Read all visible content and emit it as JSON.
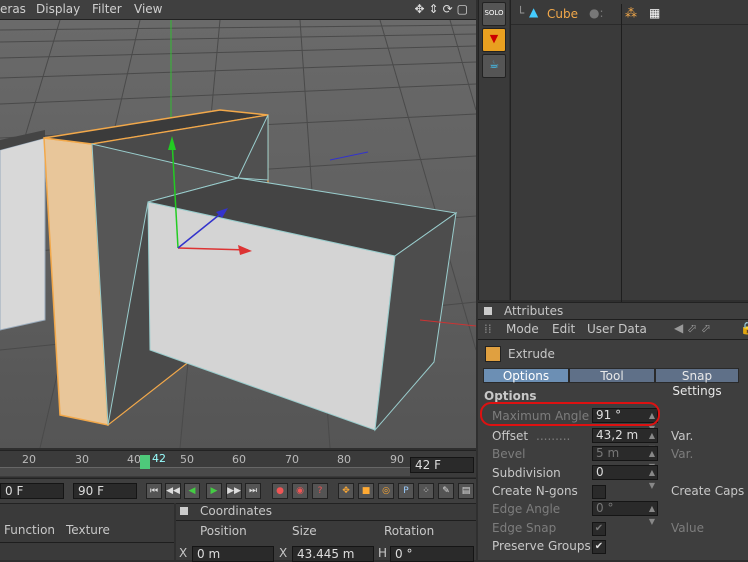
{
  "viewport": {
    "menu": [
      "eras",
      "Display",
      "Filter",
      "View"
    ],
    "nav_icons": "✥⇕⟳▢"
  },
  "timeline": {
    "ticks": [
      "20",
      "30",
      "40",
      "50",
      "60",
      "70",
      "80",
      "90"
    ],
    "current": "42",
    "end_frame": "42 F",
    "start_field": "0 F",
    "end_field": "90 F"
  },
  "materials": {
    "menu": [
      "Function",
      "Texture"
    ]
  },
  "coordinates": {
    "title": "Coordinates",
    "headers": [
      "Position",
      "Size",
      "Rotation"
    ],
    "row": {
      "x_label": "X",
      "x_val": "0 m",
      "sx_label": "X",
      "sx_val": "43.445 m",
      "h_label": "H",
      "h_val": "0 °"
    }
  },
  "object_manager": {
    "object_name": "Cube"
  },
  "attributes": {
    "title": "Attributes",
    "menu": [
      "Mode",
      "Edit",
      "User Data"
    ],
    "object": "Extrude",
    "tabs": [
      "Options",
      "Tool",
      "Snap Settings"
    ],
    "section": "Options",
    "fields": {
      "max_angle": {
        "label": "Maximum Angle",
        "value": "91 °"
      },
      "offset": {
        "label": "Offset",
        "value": "43,2 m"
      },
      "bevel": {
        "label": "Bevel",
        "value": "5 m"
      },
      "subdivision": {
        "label": "Subdivision",
        "value": "0"
      },
      "create_ngons": {
        "label": "Create N-gons"
      },
      "edge_angle": {
        "label": "Edge Angle",
        "value": "0 °"
      },
      "edge_snap": {
        "label": "Edge Snap"
      },
      "preserve_groups": {
        "label": "Preserve Groups"
      }
    },
    "right_labels": {
      "var1": "Var.",
      "var2": "Var.",
      "create_caps": "Create Caps",
      "value": "Value"
    }
  },
  "colors": {
    "selection": "#f2a84a",
    "highlight_ring": "#dd1111",
    "tab_active": "#6c8fb4",
    "playhead": "#4ec97a"
  }
}
